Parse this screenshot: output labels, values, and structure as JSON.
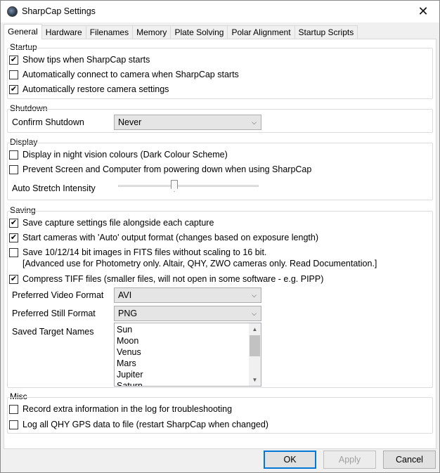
{
  "window": {
    "title": "SharpCap Settings",
    "close_glyph": "✕"
  },
  "tabs": [
    {
      "label": "General"
    },
    {
      "label": "Hardware"
    },
    {
      "label": "Filenames"
    },
    {
      "label": "Memory"
    },
    {
      "label": "Plate Solving"
    },
    {
      "label": "Polar Alignment"
    },
    {
      "label": "Startup Scripts"
    }
  ],
  "startup": {
    "title": "Startup",
    "show_tips": {
      "label": "Show tips when SharpCap starts",
      "checked": true
    },
    "auto_connect": {
      "label": "Automatically connect to camera when SharpCap starts",
      "checked": false
    },
    "auto_restore": {
      "label": "Automatically restore camera settings",
      "checked": true
    }
  },
  "shutdown": {
    "title": "Shutdown",
    "confirm_label": "Confirm Shutdown",
    "confirm_value": "Never"
  },
  "display": {
    "title": "Display",
    "night_vision": {
      "label": "Display in night vision colours (Dark Colour Scheme)",
      "checked": false
    },
    "prevent_sleep": {
      "label": "Prevent Screen and Computer from powering down when using SharpCap",
      "checked": false
    },
    "auto_stretch_label": "Auto Stretch Intensity",
    "auto_stretch_level": 0.4
  },
  "saving": {
    "title": "Saving",
    "save_settings_file": {
      "label": "Save capture settings file alongside each capture",
      "checked": true
    },
    "auto_output_format": {
      "label": "Start cameras with 'Auto' output format (changes based on exposure length)",
      "checked": true
    },
    "fits_no_scaling": {
      "label": "Save 10/12/14 bit images in FITS files without scaling to 16 bit.",
      "label_line2": "[Advanced use for Photometry only. Altair, QHY, ZWO cameras only. Read Documentation.]",
      "checked": false
    },
    "compress_tiff": {
      "label": "Compress TIFF files (smaller files, will not open in some software - e.g. PIPP)",
      "checked": true
    },
    "video_format_label": "Preferred Video Format",
    "video_format_value": "AVI",
    "still_format_label": "Preferred Still Format",
    "still_format_value": "PNG",
    "target_names_label": "Saved Target Names",
    "target_names": [
      "Sun",
      "Moon",
      "Venus",
      "Mars",
      "Jupiter",
      "Saturn"
    ]
  },
  "misc": {
    "title": "Misc",
    "extra_log": {
      "label": "Record extra information in the log for troubleshooting",
      "checked": false
    },
    "qhy_gps": {
      "label": "Log all QHY GPS data to file (restart SharpCap when changed)",
      "checked": false
    }
  },
  "buttons": {
    "ok": "OK",
    "apply": "Apply",
    "cancel": "Cancel"
  },
  "icons": {
    "app": "sharpcap-app-icon",
    "close": "close-icon",
    "dropdown": "chevron-down-icon",
    "check": "checkmark-icon",
    "scroll_up": "scroll-up-icon",
    "scroll_down": "scroll-down-icon"
  },
  "colors": {
    "default_button_border": "#0078d7",
    "panel_background": "#ffffff",
    "window_background": "#f0f0f0"
  }
}
